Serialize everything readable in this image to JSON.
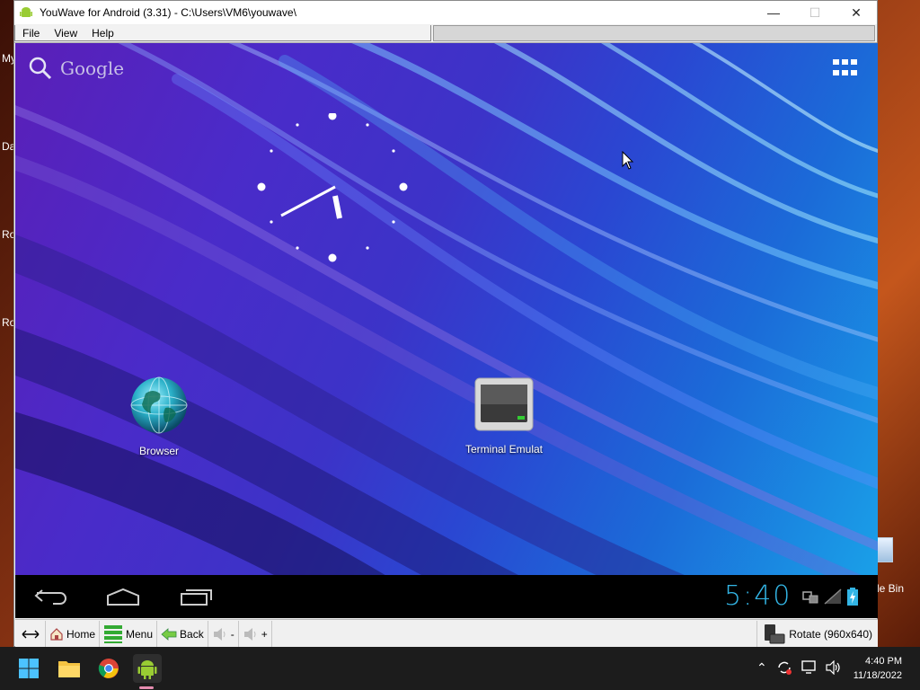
{
  "window": {
    "title": "YouWave for Android (3.31) - C:\\Users\\VM6\\youwave\\",
    "menu": [
      "File",
      "View",
      "Help"
    ]
  },
  "desktop": {
    "left_labels": [
      "My",
      "Da",
      "Ro",
      "Ro"
    ],
    "recycle_label": "le Bin"
  },
  "android": {
    "search_label": "Google",
    "apps": [
      {
        "label": "Browser",
        "icon": "globe-icon"
      },
      {
        "label": "Terminal Emulat",
        "icon": "terminal-icon"
      }
    ],
    "status_time": "5:40",
    "colors": {
      "accent": "#33b5e5"
    }
  },
  "toolbar": {
    "home_label": "Home",
    "menu_label": "Menu",
    "back_label": "Back",
    "vol_down_label": "-",
    "vol_up_label": "+",
    "rotate_label": "Rotate (960x640)"
  },
  "taskbar": {
    "time": "4:40 PM",
    "date": "11/18/2022"
  }
}
